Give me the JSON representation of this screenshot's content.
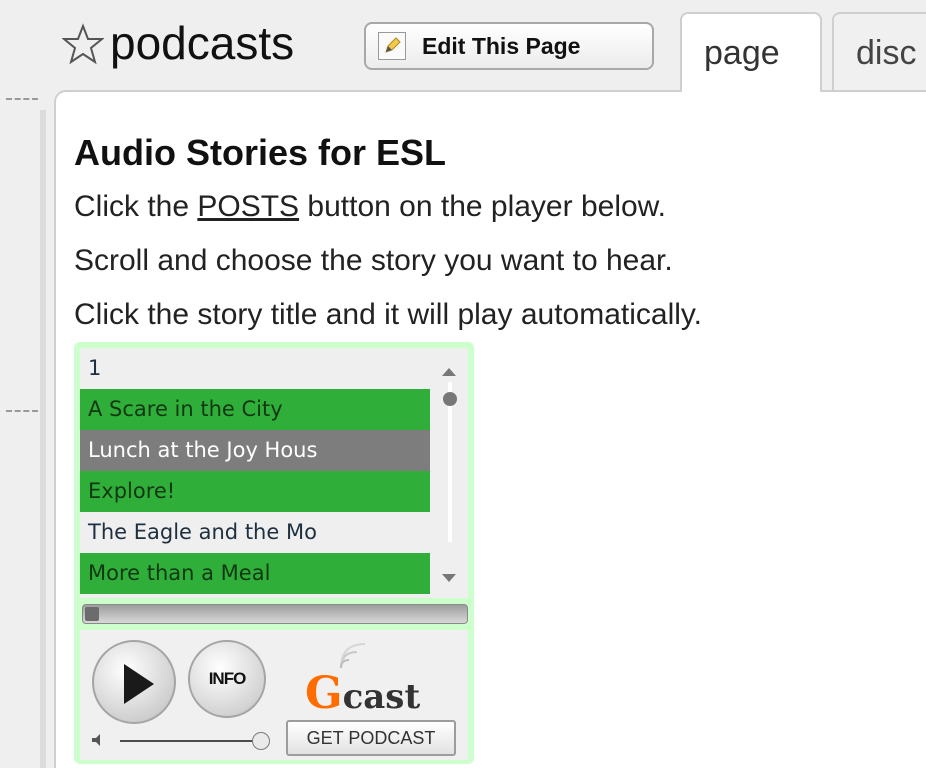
{
  "header": {
    "title": "podcasts",
    "edit_button": "Edit This Page",
    "tabs": [
      {
        "label": "page"
      },
      {
        "label": "disc"
      }
    ]
  },
  "content": {
    "heading": "Audio Stories for ESL",
    "line1_before": "Click the ",
    "line1_link": "POSTS",
    "line1_after": " button on the player below.",
    "line2": "Scroll and choose the story you want to hear.",
    "line3": "Click the story title and it will play automatically."
  },
  "player": {
    "playlist": [
      {
        "label": "1"
      },
      {
        "label": "A Scare in the City"
      },
      {
        "label": "Lunch at the Joy Hous"
      },
      {
        "label": "Explore!"
      },
      {
        "label": "The Eagle and the Mo"
      },
      {
        "label": "More than a Meal"
      }
    ],
    "info_label": "INFO",
    "logo_g": "G",
    "logo_rest": "cast",
    "get_podcast_label": "GET PODCAST",
    "progress_fraction": 0.03,
    "volume_fraction": 0.95,
    "colors": {
      "background": "#ccffcc",
      "item_green": "#2fae3a",
      "item_gray": "#7d7d7d",
      "logo_orange": "#ff6d00"
    }
  }
}
